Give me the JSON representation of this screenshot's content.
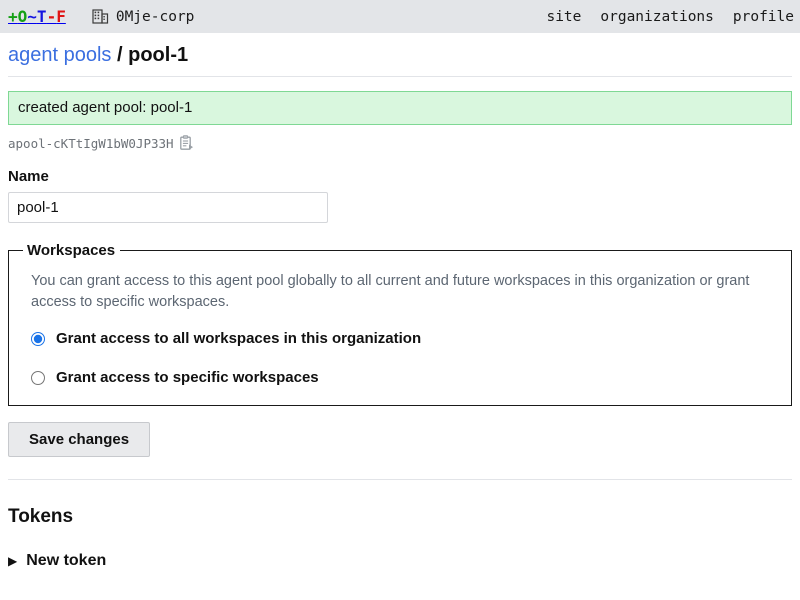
{
  "topbar": {
    "brand": {
      "parts": [
        "+",
        "O",
        "~",
        "T",
        "-",
        "F"
      ],
      "text": "+O~T-F"
    },
    "org": {
      "icon": "building-icon",
      "name": "0Mje-corp"
    },
    "nav": [
      {
        "label": "site"
      },
      {
        "label": "organizations"
      },
      {
        "label": "profile"
      }
    ],
    "colors": {
      "background": "#e3e5e8",
      "green": "#15a015",
      "blue": "#1414e0",
      "red": "#e01414"
    }
  },
  "breadcrumb": {
    "link": "agent pools",
    "separator": "/",
    "current": "pool-1",
    "link_color": "#3b6fe0"
  },
  "flash": {
    "message": "created agent pool: pool-1",
    "background": "#d9f7de",
    "border": "#7fd894"
  },
  "resource": {
    "id": "apool-cKTtIgW1bW0JP33H",
    "copy_icon": "clipboard-copy-icon"
  },
  "form": {
    "name_label": "Name",
    "name_value": "pool-1",
    "name_placeholder": "",
    "save_label": "Save changes"
  },
  "workspaces": {
    "legend": "Workspaces",
    "description": "You can grant access to this agent pool globally to all current and future workspaces in this organization or grant access to specific workspaces.",
    "options": [
      {
        "label": "Grant access to all workspaces in this organization",
        "selected": true
      },
      {
        "label": "Grant access to specific workspaces",
        "selected": false
      }
    ],
    "accent_color": "#1a73e8"
  },
  "tokens": {
    "heading": "Tokens",
    "new_token_label": "New token",
    "disclosure_glyph": "▶"
  }
}
